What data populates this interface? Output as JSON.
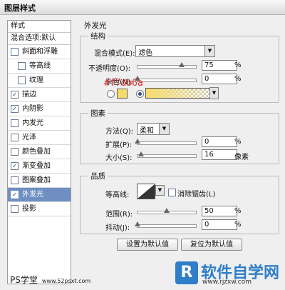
{
  "window": {
    "title": "图层样式"
  },
  "styles_panel": {
    "header": "样式",
    "blend_options": "混合选项:默认",
    "items": [
      {
        "label": "斜面和浮雕",
        "checked": false,
        "sub": false,
        "active": false
      },
      {
        "label": "等高线",
        "checked": false,
        "sub": true,
        "active": false
      },
      {
        "label": "纹理",
        "checked": false,
        "sub": true,
        "active": false
      },
      {
        "label": "描边",
        "checked": true,
        "sub": false,
        "active": false
      },
      {
        "label": "内阴影",
        "checked": true,
        "sub": false,
        "active": false
      },
      {
        "label": "内发光",
        "checked": false,
        "sub": false,
        "active": false
      },
      {
        "label": "光泽",
        "checked": false,
        "sub": false,
        "active": false
      },
      {
        "label": "颜色叠加",
        "checked": false,
        "sub": false,
        "active": false
      },
      {
        "label": "渐变叠加",
        "checked": true,
        "sub": false,
        "active": false
      },
      {
        "label": "图案叠加",
        "checked": false,
        "sub": false,
        "active": false
      },
      {
        "label": "外发光",
        "checked": true,
        "sub": false,
        "active": true
      },
      {
        "label": "投影",
        "checked": false,
        "sub": false,
        "active": false
      }
    ]
  },
  "outer_glow": {
    "title": "外发光",
    "structure": {
      "title": "结构",
      "blend_mode_label": "混合模式(E):",
      "blend_mode_value": "滤色",
      "opacity_label": "不透明度(O):",
      "opacity_value": "75",
      "opacity_level": 0.75,
      "noise_label": "杂色(N):",
      "noise_value": "0",
      "noise_level": 0,
      "color_annotation": "#f7db6a",
      "glow_color": "#f7db6a"
    },
    "elements": {
      "title": "图素",
      "technique_label": "方法(Q):",
      "technique_value": "柔和",
      "spread_label": "扩展(P):",
      "spread_value": "0",
      "spread_level": 0,
      "size_label": "大小(S):",
      "size_value": "16",
      "size_level": 0.06,
      "size_unit": "像素"
    },
    "quality": {
      "title": "品质",
      "contour_label": "等高线:",
      "antialias_label": "消除锯齿(L)",
      "range_label": "范围(R):",
      "range_value": "50",
      "range_level": 0.5,
      "jitter_label": "抖动(J):",
      "jitter_value": "0",
      "jitter_level": 0
    },
    "percent_unit": "%",
    "set_default_button": "设置为默认值",
    "reset_default_button": "复位为默认值"
  },
  "watermark": {
    "left_text": "PS学堂",
    "left_url": "www.52psxt.com",
    "logo_glyph": "R",
    "brand": "软件自学网",
    "url": "www.rjzxw.com"
  },
  "colors": {
    "active_item": "#6f8fc3",
    "annotation": "#e0302c",
    "watermark": "#2f7ec7"
  }
}
